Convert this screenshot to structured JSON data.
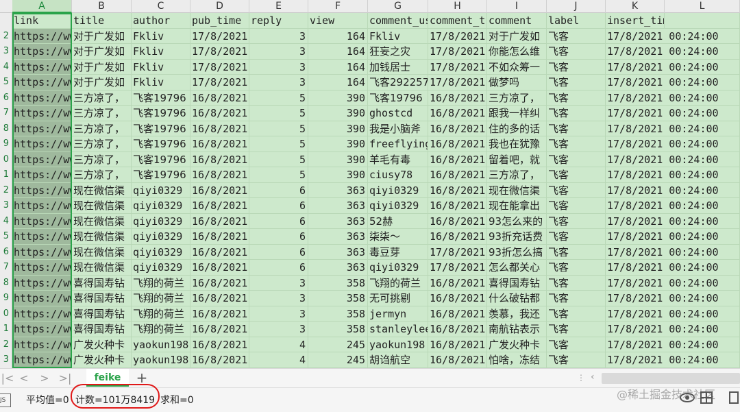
{
  "columns": [
    {
      "letter": "A",
      "header": "link"
    },
    {
      "letter": "B",
      "header": "title"
    },
    {
      "letter": "C",
      "header": "author"
    },
    {
      "letter": "D",
      "header": "pub_time"
    },
    {
      "letter": "E",
      "header": "reply"
    },
    {
      "letter": "F",
      "header": "view"
    },
    {
      "letter": "G",
      "header": "comment_us"
    },
    {
      "letter": "H",
      "header": "comment_t"
    },
    {
      "letter": "I",
      "header": "comment"
    },
    {
      "letter": "J",
      "header": "label"
    },
    {
      "letter": "K",
      "header": "insert_time"
    },
    {
      "letter": "L",
      "header": ""
    }
  ],
  "row_numbers": [
    "",
    "2",
    "3",
    "4",
    "5",
    "6",
    "7",
    "8",
    "9",
    "0",
    "1",
    "2",
    "3",
    "4",
    "5",
    "6",
    "7",
    "8",
    "9",
    "0",
    "1",
    "2",
    "3"
  ],
  "rows": [
    [
      "https://ww",
      "对于广发如",
      "Fkliv",
      "17/8/2021",
      "3",
      "164",
      "Fkliv",
      "17/8/2021",
      "对于广发如",
      "飞客",
      "17/8/2021  00:24:00"
    ],
    [
      "https://ww",
      "对于广发如",
      "Fkliv",
      "17/8/2021",
      "3",
      "164",
      "狂妄之灾",
      "17/8/2021",
      "你能怎么维",
      "飞客",
      "17/8/2021  00:24:00"
    ],
    [
      "https://ww",
      "对于广发如",
      "Fkliv",
      "17/8/2021",
      "3",
      "164",
      "加钱居士",
      "17/8/2021",
      "不如众筹一",
      "飞客",
      "17/8/2021  00:24:00"
    ],
    [
      "https://ww",
      "对于广发如",
      "Fkliv",
      "17/8/2021",
      "3",
      "164",
      "飞客292257",
      "17/8/2021",
      "做梦吗",
      "飞客",
      "17/8/2021  00:24:00"
    ],
    [
      "https://ww",
      "三方凉了，",
      "飞客19796",
      "16/8/2021",
      "5",
      "390",
      "飞客19796",
      "16/8/2021",
      "三方凉了，",
      "飞客",
      "17/8/2021  00:24:00"
    ],
    [
      "https://ww",
      "三方凉了，",
      "飞客19796",
      "16/8/2021",
      "5",
      "390",
      "ghostcd",
      "16/8/2021",
      "跟我一样纠",
      "飞客",
      "17/8/2021  00:24:00"
    ],
    [
      "https://ww",
      "三方凉了，",
      "飞客19796",
      "16/8/2021",
      "5",
      "390",
      "我是小脑斧",
      "16/8/2021",
      "住的多的话",
      "飞客",
      "17/8/2021  00:24:00"
    ],
    [
      "https://ww",
      "三方凉了，",
      "飞客19796",
      "16/8/2021",
      "5",
      "390",
      "freeflying",
      "16/8/2021",
      "我也在犹豫",
      "飞客",
      "17/8/2021  00:24:00"
    ],
    [
      "https://ww",
      "三方凉了，",
      "飞客19796",
      "16/8/2021",
      "5",
      "390",
      "羊毛有毒",
      "16/8/2021",
      "留着吧，就",
      "飞客",
      "17/8/2021  00:24:00"
    ],
    [
      "https://ww",
      "三方凉了，",
      "飞客19796",
      "16/8/2021",
      "5",
      "390",
      "ciusy78",
      "16/8/2021",
      "三方凉了，",
      "飞客",
      "17/8/2021  00:24:00"
    ],
    [
      "https://ww",
      "现在微信渠",
      "qiyi0329",
      "16/8/2021",
      "6",
      "363",
      "qiyi0329",
      "16/8/2021",
      "现在微信渠",
      "飞客",
      "17/8/2021  00:24:00"
    ],
    [
      "https://ww",
      "现在微信渠",
      "qiyi0329",
      "16/8/2021",
      "6",
      "363",
      "qiyi0329",
      "16/8/2021",
      "现在能拿出",
      "飞客",
      "17/8/2021  00:24:00"
    ],
    [
      "https://ww",
      "现在微信渠",
      "qiyi0329",
      "16/8/2021",
      "6",
      "363",
      "52赫",
      "16/8/2021",
      "93怎么来的",
      "飞客",
      "17/8/2021  00:24:00"
    ],
    [
      "https://ww",
      "现在微信渠",
      "qiyi0329",
      "16/8/2021",
      "6",
      "363",
      "柒柒～",
      "16/8/2021",
      "93折充话费",
      "飞客",
      "17/8/2021  00:24:00"
    ],
    [
      "https://ww",
      "现在微信渠",
      "qiyi0329",
      "16/8/2021",
      "6",
      "363",
      "毒豆芽",
      "17/8/2021",
      "93折怎么搞",
      "飞客",
      "17/8/2021  00:24:00"
    ],
    [
      "https://ww",
      "现在微信渠",
      "qiyi0329",
      "16/8/2021",
      "6",
      "363",
      "qiyi0329",
      "17/8/2021",
      "怎么都关心",
      "飞客",
      "17/8/2021  00:24:00"
    ],
    [
      "https://ww",
      "喜得国寿钻",
      "飞翔的荷兰",
      "16/8/2021",
      "3",
      "358",
      "飞翔的荷兰",
      "16/8/2021",
      "喜得国寿钻",
      "飞客",
      "17/8/2021  00:24:00"
    ],
    [
      "https://ww",
      "喜得国寿钻",
      "飞翔的荷兰",
      "16/8/2021",
      "3",
      "358",
      "无可挑剔",
      "16/8/2021",
      "什么破钻都",
      "飞客",
      "17/8/2021  00:24:00"
    ],
    [
      "https://ww",
      "喜得国寿钻",
      "飞翔的荷兰",
      "16/8/2021",
      "3",
      "358",
      "jermyn",
      "16/8/2021",
      "羡慕，我还",
      "飞客",
      "17/8/2021  00:24:00"
    ],
    [
      "https://ww",
      "喜得国寿钻",
      "飞翔的荷兰",
      "16/8/2021",
      "3",
      "358",
      "stanleylee",
      "16/8/2021",
      "南航钻表示",
      "飞客",
      "17/8/2021  00:24:00"
    ],
    [
      "https://ww",
      "广发火种卡",
      "yaokun198",
      "16/8/2021",
      "4",
      "245",
      "yaokun198",
      "16/8/2021",
      "广发火种卡",
      "飞客",
      "17/8/2021  00:24:00"
    ],
    [
      "https://ww",
      "广发火种卡",
      "yaokun198",
      "16/8/2021",
      "4",
      "245",
      "胡诌航空",
      "16/8/2021",
      "怕啥，冻结",
      "飞客",
      "17/8/2021  00:24:00"
    ]
  ],
  "sheet_tabs": {
    "nav_first": "|<",
    "nav_prev": "<",
    "nav_next": ">",
    "nav_last": ">|",
    "active_tab": "feike",
    "add_tab": "+"
  },
  "status": {
    "average": "平均值=0",
    "count": "计数=101万8419",
    "sum": "求和=0",
    "left_icon_text": "JS"
  },
  "watermark": "@稀土掘金技术社区",
  "colors": {
    "cell_fill": "#cde9cc",
    "selected_column_fill": "#9fb99d",
    "accent_green": "#2aa34a",
    "annotation_red": "#e01818"
  }
}
